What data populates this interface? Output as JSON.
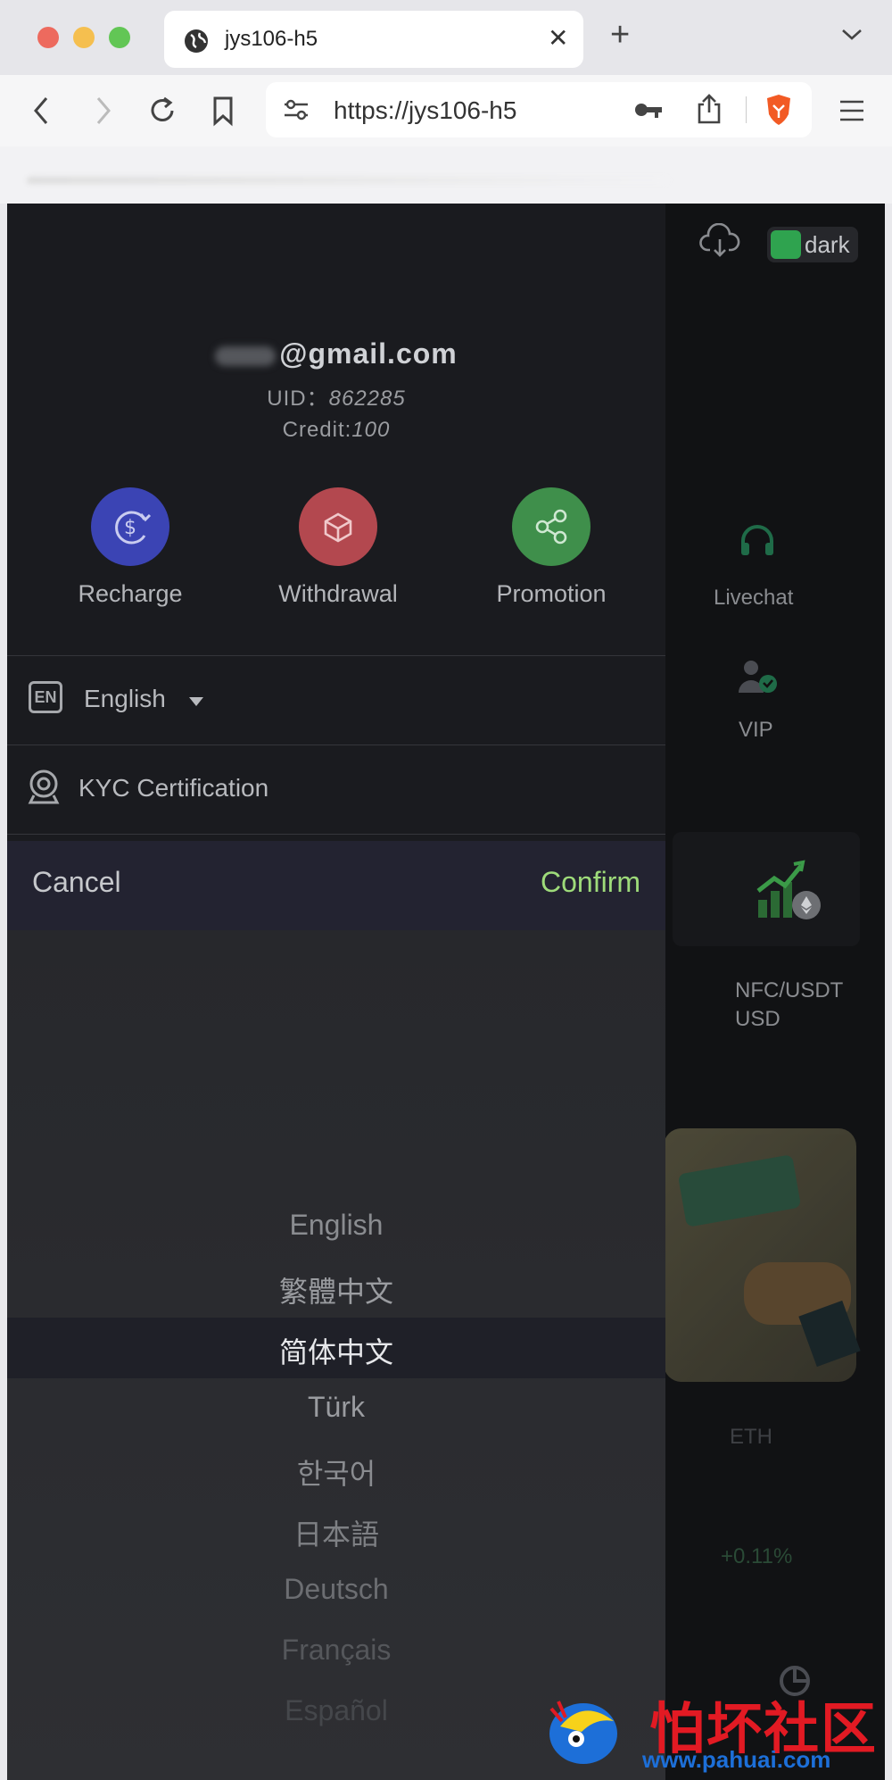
{
  "browser": {
    "tab_title": "jys106-h5",
    "url": "https://jys106-h5"
  },
  "background": {
    "theme_label": "dark",
    "livechat": "Livechat",
    "vip": "VIP",
    "pair_line1": "NFC/USDT",
    "pair_line2": "USD",
    "coin": "ETH",
    "change": "+0.11%"
  },
  "drawer": {
    "email_suffix": "@gmail.com",
    "uid_label": "UID：",
    "uid_value": "862285",
    "credit_label": "Credit:",
    "credit_value": "100",
    "actions": [
      {
        "label": "Recharge",
        "icon": "dollar-cycle-icon",
        "color": "#3b44b4"
      },
      {
        "label": "Withdrawal",
        "icon": "box-icon",
        "color": "#b3484f"
      },
      {
        "label": "Promotion",
        "icon": "share-icon",
        "color": "#3f8f4b"
      }
    ],
    "language_badge": "EN",
    "language_current": "English",
    "kyc_label": "KYC Certification"
  },
  "picker": {
    "cancel": "Cancel",
    "confirm": "Confirm",
    "options": [
      "English",
      "繁體中文",
      "简体中文",
      "Türk",
      "한국어",
      "日本語",
      "Deutsch",
      "Français",
      "Español"
    ],
    "selected_index": 2
  },
  "watermark": {
    "text": "怕坏社区",
    "url": "www.pahuai.com"
  },
  "colors": {
    "accent_confirm": "#9edb7a",
    "drawer_bg": "#1a1b1f",
    "watermark_red": "#e21a23"
  }
}
